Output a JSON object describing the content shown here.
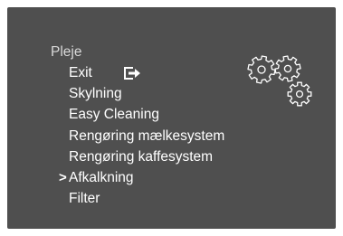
{
  "menu": {
    "title": "Pleje",
    "items": [
      {
        "label": "Exit",
        "icon": "exit-arrow-icon",
        "selected": false
      },
      {
        "label": "Skylning",
        "selected": false
      },
      {
        "label": "Easy Cleaning",
        "selected": false
      },
      {
        "label": "Rengøring mælkesystem",
        "selected": false
      },
      {
        "label": "Rengøring kaffesystem",
        "selected": false
      },
      {
        "label": "Afkalkning",
        "selected": true
      },
      {
        "label": "Filter",
        "selected": false
      }
    ],
    "cursor_glyph": ">"
  },
  "icons": {
    "header_graphic": "gears-icon"
  },
  "colors": {
    "screen_bg": "#4f4f4f",
    "text": "#ffffff",
    "title_text": "#d9d9d9"
  }
}
